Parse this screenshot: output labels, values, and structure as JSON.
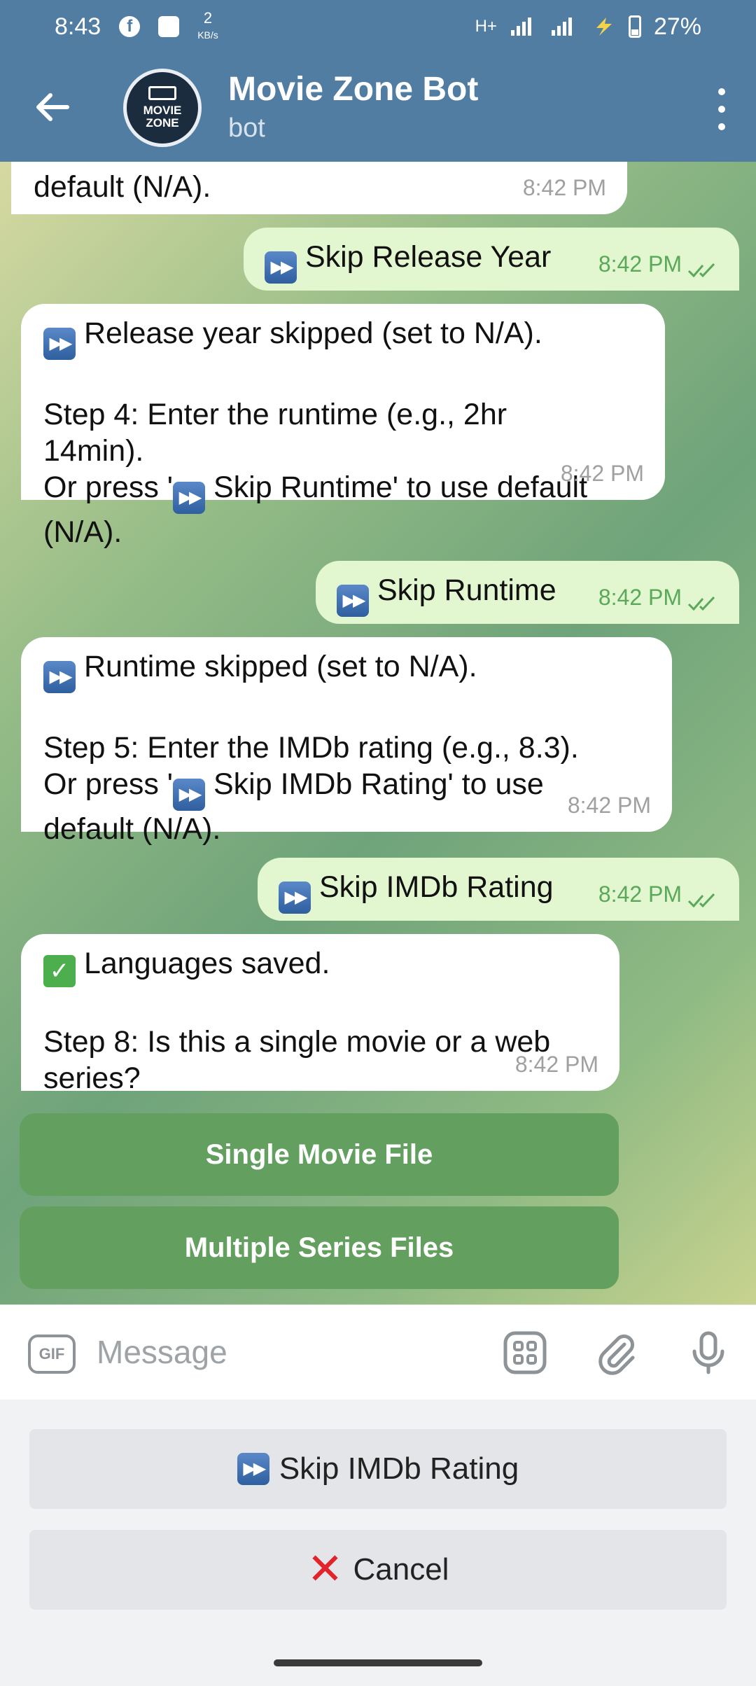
{
  "status_bar": {
    "time": "8:43",
    "net_speed_value": "2",
    "net_speed_unit": "KB/s",
    "network": "H+",
    "battery": "27%"
  },
  "header": {
    "title": "Movie Zone Bot",
    "subtitle": "bot",
    "avatar_text_1": "MOVIE",
    "avatar_text_2": "ZONE"
  },
  "messages": [
    {
      "dir": "in",
      "text": "default (N/A).",
      "time": "8:42 PM"
    },
    {
      "dir": "out",
      "text": "Skip Release Year",
      "time": "8:42 PM"
    },
    {
      "dir": "in",
      "line1": "Release year skipped (set to N/A).",
      "line2": "Step 4: Enter the runtime (e.g., 2hr\n14min).",
      "line3_a": "Or press '",
      "line3_b": " Skip Runtime' to use default\n(N/A).",
      "time": "8:42 PM"
    },
    {
      "dir": "out",
      "text": "Skip Runtime",
      "time": "8:42 PM"
    },
    {
      "dir": "in",
      "line1": "Runtime skipped (set to N/A).",
      "line2": "Step 5: Enter the IMDb rating (e.g., 8.3).",
      "line3_a": "Or press '",
      "line3_b": " Skip IMDb Rating' to use\ndefault (N/A).",
      "time": "8:42 PM"
    },
    {
      "dir": "out",
      "text": "Skip IMDb Rating",
      "time": "8:42 PM"
    },
    {
      "dir": "in",
      "line1": "Languages saved.",
      "line2": "Step 8: Is this a single movie or a web\nseries?",
      "time": "8:42 PM"
    }
  ],
  "inline_buttons": [
    "Single Movie File",
    "Multiple Series Files"
  ],
  "input": {
    "placeholder": "Message",
    "gif_label": "GIF"
  },
  "reply_keyboard": {
    "skip_label": "Skip IMDb Rating",
    "cancel_label": "Cancel"
  },
  "colors": {
    "header": "#527da3",
    "outgoing": "#e2f6cf",
    "inline_button": "#63a05f"
  }
}
